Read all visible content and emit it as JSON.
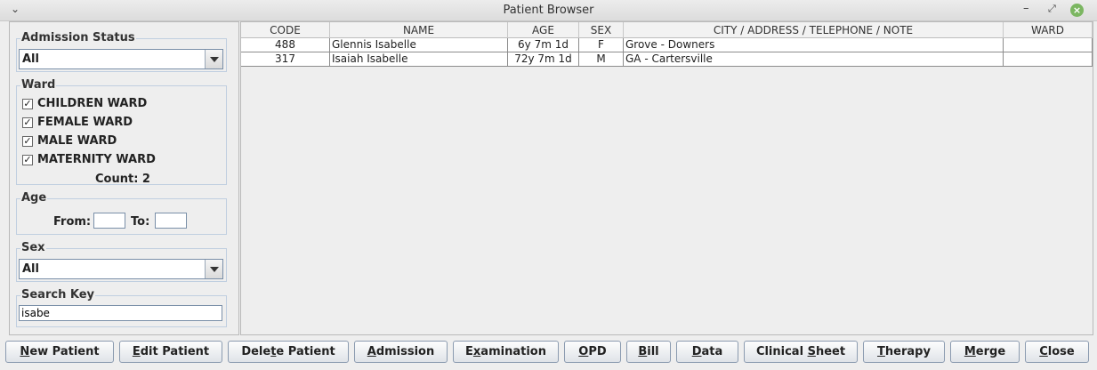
{
  "window": {
    "title": "Patient Browser",
    "menu_glyph": "⌄",
    "minimize_glyph": "–",
    "maximize_glyph": "⤢",
    "close_glyph": "×"
  },
  "filters": {
    "admission_status": {
      "label": "Admission Status",
      "value": "All"
    },
    "ward": {
      "label": "Ward",
      "items": [
        {
          "label": "CHILDREN WARD",
          "checked": true
        },
        {
          "label": "FEMALE WARD",
          "checked": true
        },
        {
          "label": "MALE WARD",
          "checked": true
        },
        {
          "label": "MATERNITY WARD",
          "checked": true
        }
      ],
      "count_text": "Count: 2",
      "check_glyph": "✓"
    },
    "age": {
      "label": "Age",
      "from_label": "From:",
      "to_label": "To:",
      "from_value": "",
      "to_value": ""
    },
    "sex": {
      "label": "Sex",
      "value": "All"
    },
    "search": {
      "label": "Search Key",
      "value": "isabe"
    }
  },
  "table": {
    "columns": [
      "CODE",
      "NAME",
      "AGE",
      "SEX",
      "CITY / ADDRESS / TELEPHONE / NOTE",
      "WARD"
    ],
    "rows": [
      [
        "488",
        "Glennis Isabelle",
        "6y 7m 1d",
        "F",
        "Grove - Downers",
        ""
      ],
      [
        "317",
        "Isaiah Isabelle",
        "72y 7m 1d",
        "M",
        "GA - Cartersville",
        ""
      ]
    ]
  },
  "buttons": [
    {
      "pre": "",
      "u": "N",
      "post": "ew Patient"
    },
    {
      "pre": "",
      "u": "E",
      "post": "dit Patient"
    },
    {
      "pre": "Dele",
      "u": "t",
      "post": "e Patient"
    },
    {
      "pre": "",
      "u": "A",
      "post": "dmission"
    },
    {
      "pre": "E",
      "u": "x",
      "post": "amination"
    },
    {
      "pre": "",
      "u": "O",
      "post": "PD"
    },
    {
      "pre": "",
      "u": "B",
      "post": "ill"
    },
    {
      "pre": "",
      "u": "D",
      "post": "ata"
    },
    {
      "pre": "Clinical ",
      "u": "S",
      "post": "heet"
    },
    {
      "pre": "",
      "u": "T",
      "post": "herapy"
    },
    {
      "pre": "",
      "u": "M",
      "post": "erge"
    },
    {
      "pre": "",
      "u": "C",
      "post": "lose"
    }
  ]
}
